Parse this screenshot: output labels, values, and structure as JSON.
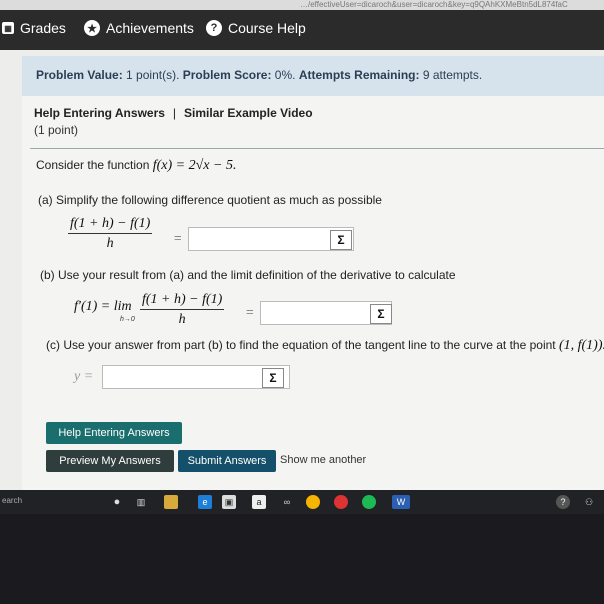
{
  "browser": {
    "url_fragment": "…/effectiveUser=dicaroch&user=dicaroch&key=q9QAhKXMeBtn5dL874faC"
  },
  "nav": {
    "grades": "Grades",
    "achievements": "Achievements",
    "course_help": "Course Help"
  },
  "info": {
    "problem_value_label": "Problem Value:",
    "problem_value": "1 point(s).",
    "problem_score_label": "Problem Score:",
    "problem_score": "0%.",
    "attempts_label": "Attempts Remaining:",
    "attempts": "9 attempts."
  },
  "problem": {
    "help_link": "Help Entering Answers",
    "separator": "|",
    "video_link": "Similar Example Video",
    "points": "(1 point)",
    "intro": "Consider the function",
    "function": "f(x) = 2√x − 5.",
    "part_a_text": "(a)  Simplify the following difference quotient as much as possible",
    "quotient_num": "f(1 + h) − f(1)",
    "quotient_den": "h",
    "part_b_text": "(b)  Use your result from (a) and the limit definition of the derivative to calculate",
    "deriv_lhs": "f′(1) = lim",
    "limit_sub": "h→0",
    "part_c_text": "(c)  Use your answer from part (b) to find the equation of the tangent line to the curve at the point",
    "point": "(1, f(1)).",
    "y_label": "y =",
    "equals": "=",
    "sigma": "Σ"
  },
  "buttons": {
    "help": "Help Entering Answers",
    "preview": "Preview My Answers",
    "submit": "Submit Answers",
    "show_another": "Show me another"
  },
  "taskbar": {
    "search": "earch"
  }
}
